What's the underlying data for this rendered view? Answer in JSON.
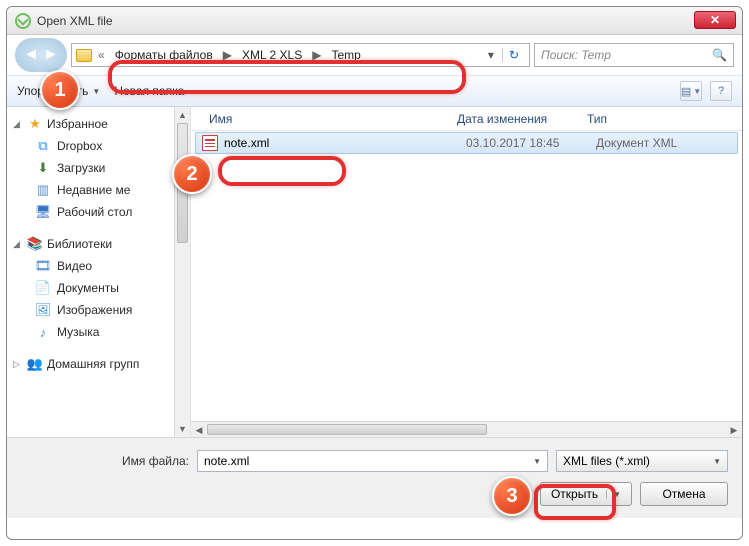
{
  "window": {
    "title": "Open XML file"
  },
  "address": {
    "chev": "«",
    "crumbs": [
      "Форматы файлов",
      "XML 2 XLS",
      "Temp"
    ],
    "sep": "▶"
  },
  "search": {
    "placeholder": "Поиск: Temp"
  },
  "toolbar": {
    "organize": "Упорядочить",
    "newfolder": "Новая папка"
  },
  "sidebar": {
    "favorites": {
      "label": "Избранное",
      "items": [
        "Dropbox",
        "Загрузки",
        "Недавние ме",
        "Рабочий стол"
      ]
    },
    "libraries": {
      "label": "Библиотеки",
      "items": [
        "Видео",
        "Документы",
        "Изображения",
        "Музыка"
      ]
    },
    "homegroup": {
      "label": "Домашняя групп"
    }
  },
  "columns": {
    "name": "Имя",
    "modified": "Дата изменения",
    "type": "Тип"
  },
  "files": [
    {
      "name": "note.xml",
      "modified": "03.10.2017 18:45",
      "type": "Документ XML"
    }
  ],
  "bottom": {
    "filelabel": "Имя файла:",
    "filename": "note.xml",
    "filter": "XML files (*.xml)",
    "open": "Открыть",
    "cancel": "Отмена"
  },
  "annotations": {
    "n1": "1",
    "n2": "2",
    "n3": "3"
  }
}
